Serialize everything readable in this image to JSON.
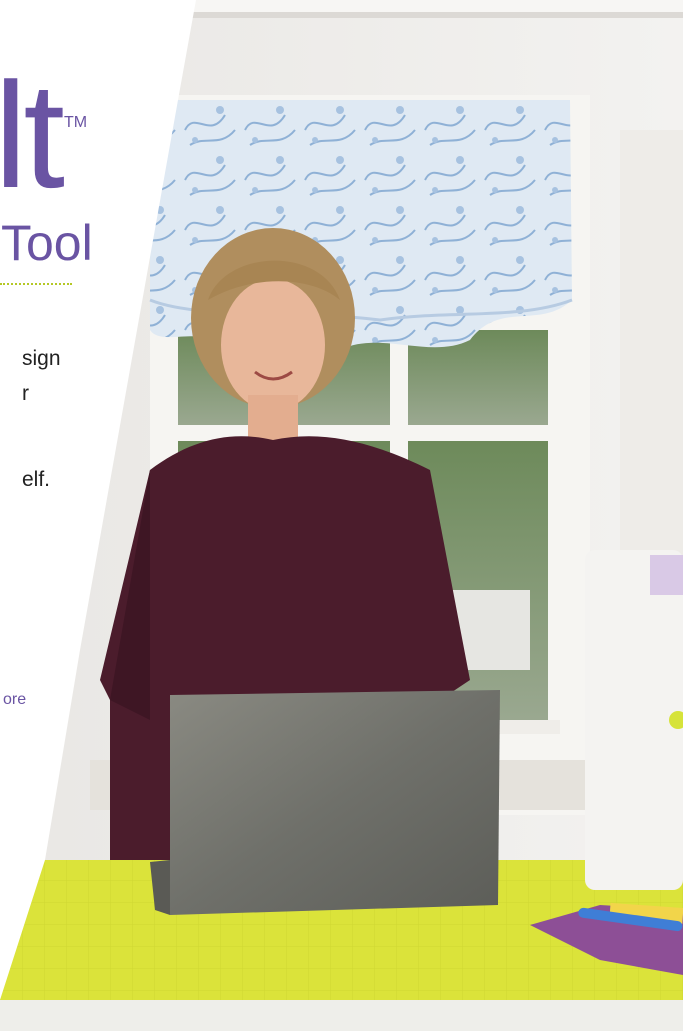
{
  "brand": {
    "title_fragment": "lt",
    "trademark": "TM",
    "subtitle": "Tool"
  },
  "body_lines": [
    "sign",
    "r",
    "elf."
  ],
  "more_link": "ore",
  "colors": {
    "brand_purple": "#6a54a3",
    "accent_lime": "#b5c826",
    "mat_yellow": "#dbe33a"
  },
  "photo": {
    "description_icon": "woman-at-laptop-photo"
  }
}
